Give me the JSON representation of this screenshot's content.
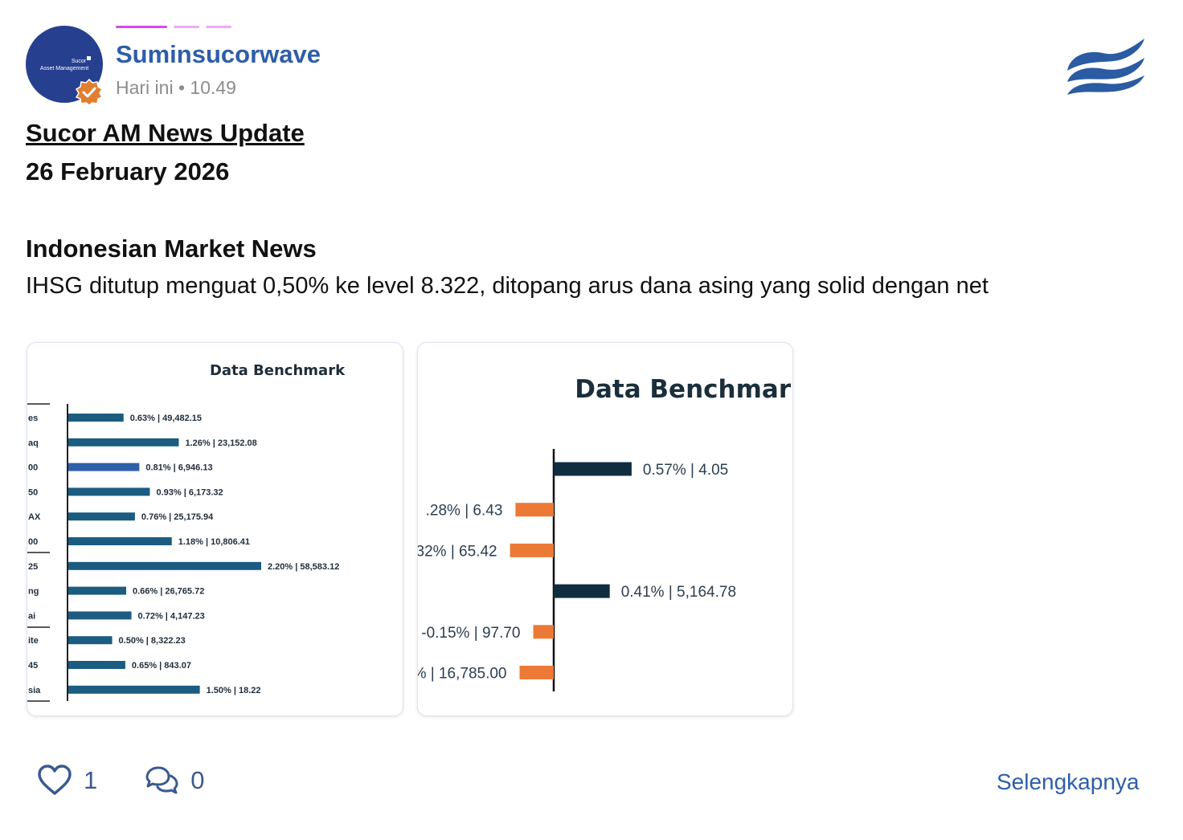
{
  "post": {
    "author": "Suminsucorwave",
    "time": "Hari ini • 10.49",
    "avatar_lines": [
      "Sucor",
      "Asset Management"
    ],
    "title": "Sucor AM News Update",
    "date": "26 February 2026",
    "section_title": "Indonesian Market News",
    "body": "IHSG ditutup menguat 0,50% ke level 8.322, ditopang arus dana asing yang solid dengan net",
    "likes": "1",
    "comments": "0",
    "more_label": "Selengkapnya"
  },
  "icons": {
    "verified": "verified-badge-icon",
    "logo": "wave-logo-icon",
    "like": "heart-icon",
    "comment": "comment-bubbles-icon"
  },
  "colors": {
    "author": "#2e5ea8",
    "avatar": "#263f8f",
    "verified": "#e07f30",
    "dash_primary": "#d946ef",
    "dash_secondary": "#f0a9f7",
    "bar_dark": "#1b5c80",
    "bar_highlight": "#2f5fa8",
    "bar_navy": "#0f2d3f",
    "bar_orange": "#ec7a36"
  },
  "chart_data": [
    {
      "type": "bar",
      "orientation": "horizontal",
      "title": "Data Benchmark",
      "categories": [
        "es",
        "aq",
        "00",
        "50",
        "AX",
        "00",
        "25",
        "ng",
        "ai",
        "ite",
        "45",
        "sia"
      ],
      "series": [
        {
          "values": [
            0.63,
            1.26,
            0.81,
            0.93,
            0.76,
            1.18,
            2.2,
            0.66,
            0.72,
            0.5,
            0.65,
            1.5
          ],
          "labels": [
            "0.63% | 49,482.15",
            "1.26% | 23,152.08",
            "0.81% | 6,946.13",
            "0.93% | 6,173.32",
            "0.76% | 25,175.94",
            "1.18% | 10,806.41",
            "2.20% | 58,583.12",
            "0.66% | 26,765.72",
            "0.72% | 4,147.23",
            "0.50% | 8,322.23",
            "0.65% | 843.07",
            "1.50% | 18.22"
          ],
          "highlight_index": 2
        }
      ],
      "xlim": [
        0,
        2.2
      ],
      "grid": false,
      "legend": "none"
    },
    {
      "type": "bar",
      "orientation": "horizontal",
      "title": "Data Benchmark",
      "categories": [
        "",
        "",
        "",
        "",
        "",
        ""
      ],
      "series": [
        {
          "values": [
            0.57,
            -0.28,
            -0.32,
            0.41,
            -0.15,
            -0.25
          ],
          "labels": [
            "0.57% | 4.05",
            ".28% | 6.43",
            "32% | 65.42",
            "0.41% | 5,164.78",
            "-0.15% | 97.70",
            "% | 16,785.00"
          ]
        }
      ],
      "xlim": [
        -0.6,
        1.6
      ],
      "grid": false,
      "legend": "none"
    }
  ]
}
